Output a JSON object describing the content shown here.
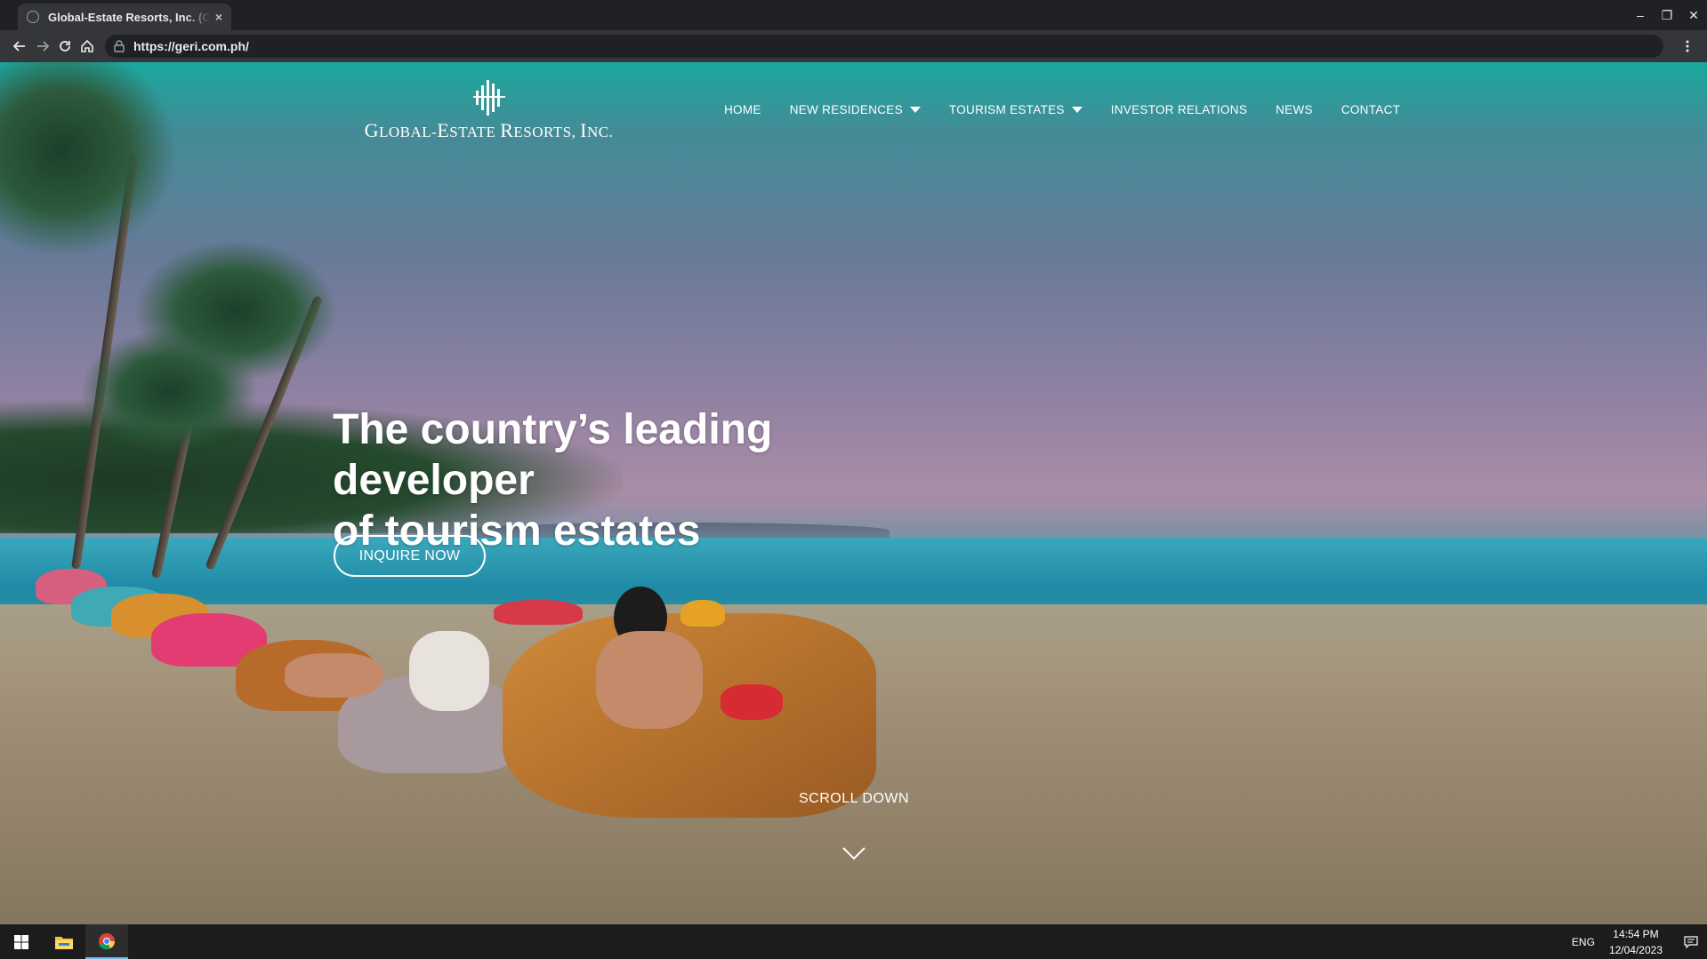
{
  "browser": {
    "tab_title": "Global-Estate Resorts, Inc. (GERI)",
    "tab_close": "×",
    "url": "https://geri.com.ph/",
    "window_controls": [
      "–",
      "❐",
      "✕"
    ]
  },
  "site": {
    "logo_text_main_1": "G",
    "logo_text_small_1": "LOBAL-",
    "logo_text_main_2": "E",
    "logo_text_small_2": "STATE ",
    "logo_text_main_3": "R",
    "logo_text_small_3": "ESORTS, ",
    "logo_text_main_4": "I",
    "logo_text_small_4": "NC.",
    "nav": [
      {
        "label": "HOME",
        "dropdown": false
      },
      {
        "label": "NEW RESIDENCES",
        "dropdown": true
      },
      {
        "label": "TOURISM ESTATES",
        "dropdown": true
      },
      {
        "label": "INVESTOR RELATIONS",
        "dropdown": false
      },
      {
        "label": "NEWS",
        "dropdown": false
      },
      {
        "label": "CONTACT",
        "dropdown": false
      }
    ]
  },
  "hero": {
    "title_line1": "The country’s leading developer",
    "title_line2": "of tourism estates",
    "cta_label": "INQUIRE NOW",
    "scroll_label": "SCROLL DOWN"
  },
  "taskbar": {
    "language": "ENG",
    "time": "14:54 PM",
    "date": "12/04/2023"
  },
  "colors": {
    "header_teal": "#1aa89e",
    "taskbar": "#1c1c1c",
    "chrome_dark": "#202124"
  }
}
